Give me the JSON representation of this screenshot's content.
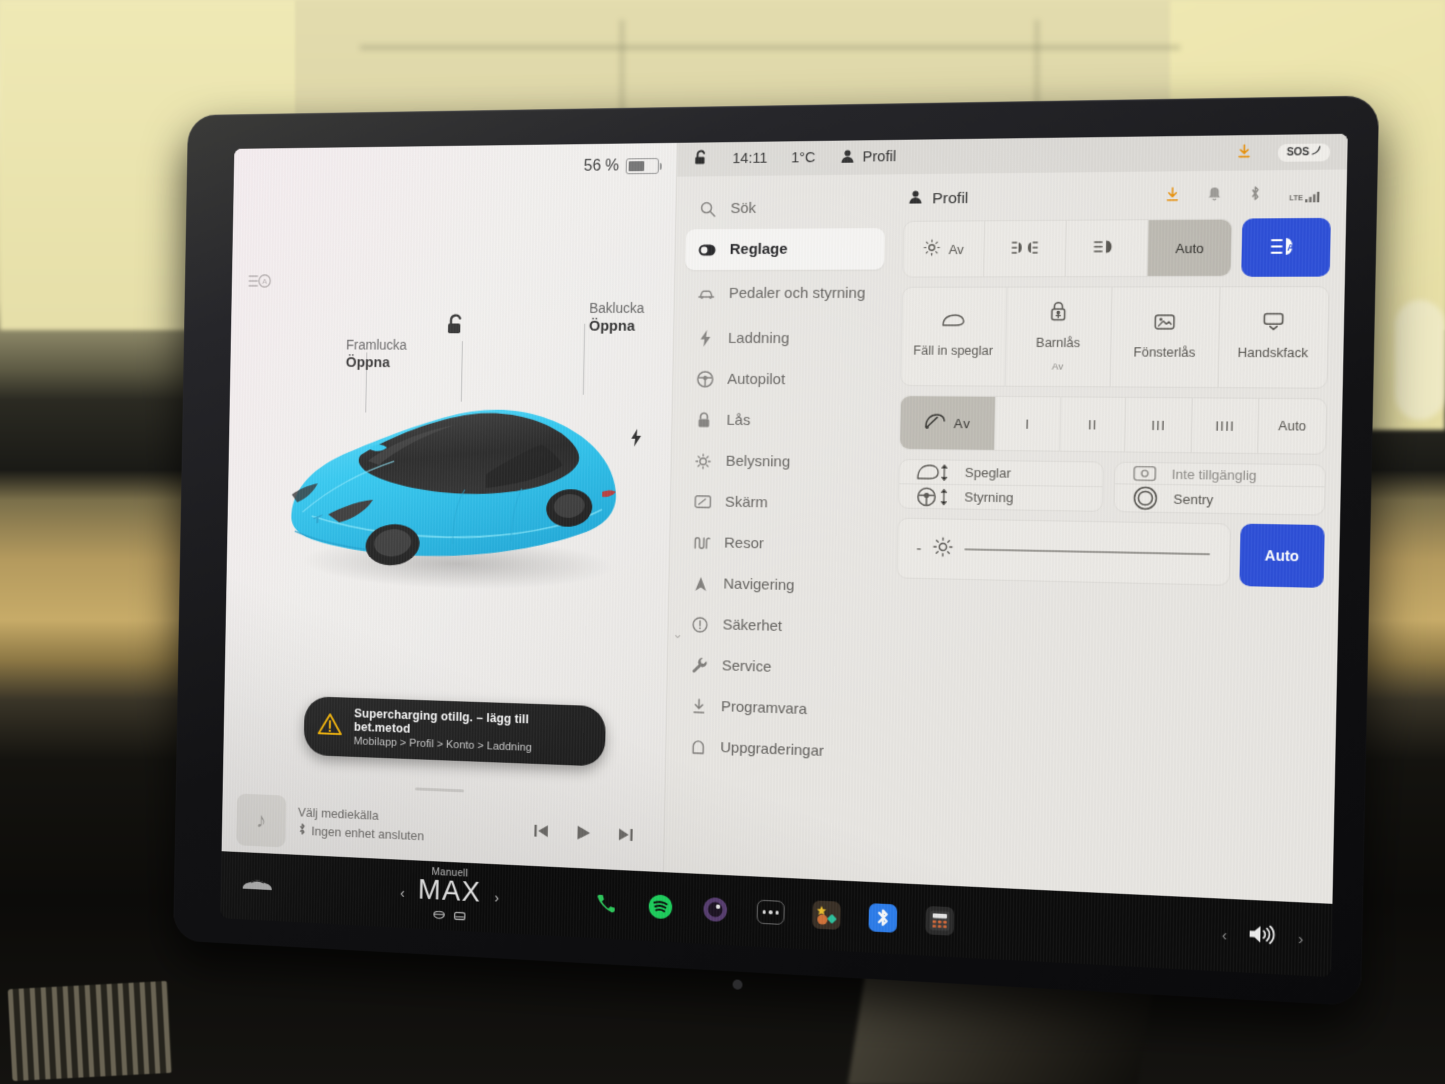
{
  "statusbar": {
    "lock_icon": "unlocked-padlock-icon",
    "time": "14:11",
    "temperature": "1°C",
    "profile_icon": "person-icon",
    "profile_label": "Profil",
    "download_icon": "download-icon",
    "sos_label": "SOS"
  },
  "left_pane": {
    "battery_percent": "56 %",
    "battery_fill_pct": 56,
    "autobeam_icon": "auto-high-beam-icon",
    "lock_icon": "open-padlock-icon",
    "charge_port_icon": "charge-bolt-icon",
    "callouts": [
      {
        "title": "Framlucka",
        "action": "Öppna"
      },
      {
        "title": "Baklucka",
        "action": "Öppna"
      }
    ],
    "car_color": "#29c2ee",
    "toast": {
      "warning_icon": "warning-triangle-icon",
      "title": "Supercharging otillg. – lägg till bet.metod",
      "subtitle": "Mobilapp > Profil > Konto > Laddning"
    },
    "media": {
      "art_icon": "music-note-icon",
      "title": "Välj mediekälla",
      "bt_icon": "bluetooth-icon",
      "subtitle": "Ingen enhet ansluten",
      "prev_icon": "skip-previous-icon",
      "play_icon": "play-icon",
      "next_icon": "skip-next-icon"
    }
  },
  "sidebar": {
    "items": [
      {
        "label": "Sök",
        "icon": "search-icon",
        "active": false
      },
      {
        "label": "Reglage",
        "icon": "toggle-icon",
        "active": true
      },
      {
        "label": "Pedaler och styrning",
        "icon": "car-icon",
        "active": false
      },
      {
        "label": "Laddning",
        "icon": "bolt-icon",
        "active": false
      },
      {
        "label": "Autopilot",
        "icon": "steering-wheel-icon",
        "active": false
      },
      {
        "label": "Lås",
        "icon": "lock-icon",
        "active": false
      },
      {
        "label": "Belysning",
        "icon": "sun-icon",
        "active": false
      },
      {
        "label": "Skärm",
        "icon": "display-icon",
        "active": false
      },
      {
        "label": "Resor",
        "icon": "trips-icon",
        "active": false
      },
      {
        "label": "Navigering",
        "icon": "navigation-arrow-icon",
        "active": false
      },
      {
        "label": "Säkerhet",
        "icon": "alert-circle-icon",
        "active": false
      },
      {
        "label": "Service",
        "icon": "wrench-icon",
        "active": false
      },
      {
        "label": "Programvara",
        "icon": "download-icon",
        "active": false
      },
      {
        "label": "Uppgraderingar",
        "icon": "upgrade-icon",
        "active": false
      }
    ]
  },
  "content": {
    "header_icon": "person-icon",
    "header_title": "Profil",
    "header_icons": [
      "download-icon",
      "bell-icon",
      "bluetooth-icon",
      "lte-signal-icon"
    ],
    "lte_label": "LTE",
    "lights_segments": [
      {
        "label": "Av",
        "icon": "parking-light-icon",
        "selected": false
      },
      {
        "label": "",
        "icon": "fog-light-icon",
        "selected": false
      },
      {
        "label": "",
        "icon": "low-beam-icon",
        "selected": false
      },
      {
        "label": "Auto",
        "icon": "",
        "selected": true
      }
    ],
    "highbeam_button": {
      "icon": "auto-high-beam-icon",
      "accent": "#2e50d8"
    },
    "tiles": [
      {
        "label": "Fäll in speglar",
        "icon": "mirror-icon",
        "sub": ""
      },
      {
        "label": "Barnlås",
        "icon": "child-lock-icon",
        "sub": "Av"
      },
      {
        "label": "Fönsterlås",
        "icon": "window-lock-icon",
        "sub": ""
      },
      {
        "label": "Handskfack",
        "icon": "glovebox-icon",
        "sub": ""
      }
    ],
    "wipers": [
      {
        "label": "Av",
        "icon": "wiper-icon",
        "selected": true
      },
      {
        "label": "I",
        "icon": "",
        "selected": false
      },
      {
        "label": "II",
        "icon": "",
        "selected": false
      },
      {
        "label": "III",
        "icon": "",
        "selected": false
      },
      {
        "label": "IIII",
        "icon": "",
        "selected": false
      },
      {
        "label": "Auto",
        "icon": "",
        "selected": false
      }
    ],
    "cards_left": [
      {
        "label": "Speglar",
        "icon": "mirror-adjust-icon"
      },
      {
        "label": "Styrning",
        "icon": "steering-adjust-icon"
      }
    ],
    "cards_right": [
      {
        "label": "Inte tillgänglig",
        "icon": "camera-icon"
      },
      {
        "label": "Sentry",
        "icon": "sentry-mode-icon"
      }
    ],
    "brightness": {
      "minus_label": "-",
      "icon": "brightness-icon",
      "value_pct": 100
    },
    "auto_button": {
      "label": "Auto",
      "accent": "#2e50d8"
    }
  },
  "dock": {
    "car_icon": "car-front-icon",
    "climate": {
      "prev_icon": "chevron-left-icon",
      "mode": "Manuell",
      "temperature": "MAX",
      "next_icon": "chevron-right-icon",
      "seat_icons": [
        "steering-heat-icon",
        "seat-heat-icon"
      ]
    },
    "apps": [
      {
        "name": "phone-app-icon",
        "color": "#2fd360"
      },
      {
        "name": "spotify-app-icon",
        "color": "#1ed760"
      },
      {
        "name": "camera-app-icon",
        "color": "#6a4b86"
      },
      {
        "name": "more-apps-icon",
        "color": "#1a1a1a"
      },
      {
        "name": "toybox-app-icon",
        "color": "#3a3a3a"
      },
      {
        "name": "bluetooth-app-icon",
        "color": "#2d7ff0"
      },
      {
        "name": "calculator-app-icon",
        "color": "#2a2a2a"
      }
    ],
    "volume": {
      "prev_icon": "chevron-left-icon",
      "speaker_icon": "volume-icon",
      "next_icon": "chevron-right-icon"
    }
  }
}
